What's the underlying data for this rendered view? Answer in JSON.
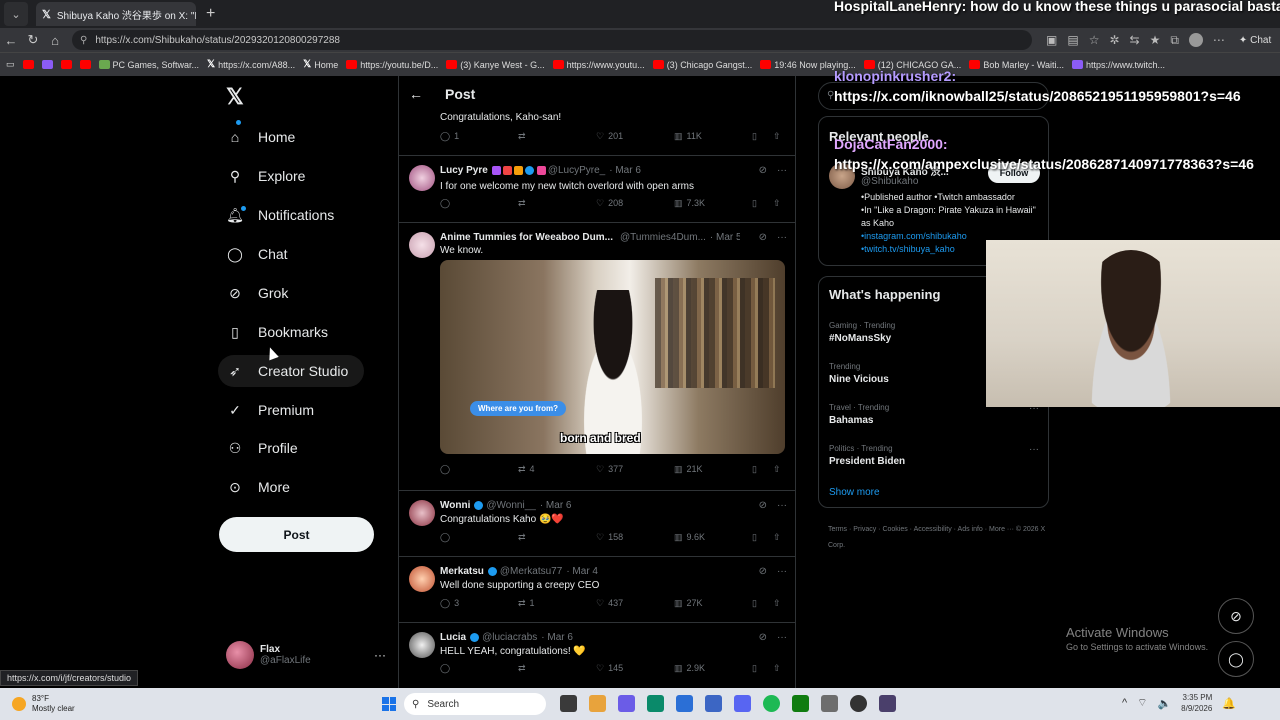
{
  "browser": {
    "tab_title": "Shibuya Kaho 渋谷果歩 on X: \"I'm",
    "url": "https://x.com/Shibukaho/status/2029320120800297288",
    "chat_label": "Chat",
    "bookmarks": [
      {
        "label": "",
        "icon": "youtube-icon"
      },
      {
        "label": "",
        "icon": "twitch-icon"
      },
      {
        "label": "",
        "icon": "youtube-icon"
      },
      {
        "label": "",
        "icon": "youtube-icon"
      },
      {
        "label": "PC Games, Softwar...",
        "icon": "game-icon"
      },
      {
        "label": "https://x.com/A88...",
        "icon": "x-icon"
      },
      {
        "label": "Home",
        "icon": "x-icon"
      },
      {
        "label": "https://youtu.be/D...",
        "icon": "youtube-icon"
      },
      {
        "label": "(3) Kanye West - G...",
        "icon": "youtube-icon"
      },
      {
        "label": "https://www.youtu...",
        "icon": "youtube-icon"
      },
      {
        "label": "(3) Chicago Gangst...",
        "icon": "youtube-icon"
      },
      {
        "label": "19:46 Now playing...",
        "icon": "youtube-icon"
      },
      {
        "label": "(12) CHICAGO GA...",
        "icon": "youtube-icon"
      },
      {
        "label": "Bob Marley - Waiti...",
        "icon": "youtube-icon"
      },
      {
        "label": "https://www.twitch...",
        "icon": "twitch-icon"
      }
    ]
  },
  "nav": {
    "items": [
      {
        "label": "Home",
        "icon": "home-icon"
      },
      {
        "label": "Explore",
        "icon": "search-icon"
      },
      {
        "label": "Notifications",
        "icon": "bell-icon"
      },
      {
        "label": "Chat",
        "icon": "chat-icon"
      },
      {
        "label": "Grok",
        "icon": "grok-icon"
      },
      {
        "label": "Bookmarks",
        "icon": "bookmark-icon"
      },
      {
        "label": "Creator Studio",
        "icon": "rocket-icon"
      },
      {
        "label": "Premium",
        "icon": "verified-icon"
      },
      {
        "label": "Profile",
        "icon": "person-icon"
      },
      {
        "label": "More",
        "icon": "more-icon"
      }
    ],
    "post_label": "Post",
    "account": {
      "name": "Flax",
      "handle": "@aFlaxLife"
    }
  },
  "header": {
    "title": "Post"
  },
  "tweets": [
    {
      "text": "Congratulations, Kaho-san!",
      "replies": "1",
      "retweets": "",
      "likes": "201",
      "views": "11K"
    },
    {
      "name": "Lucy Pyre",
      "handle": "@LucyPyre_",
      "date": "· Mar 6",
      "text": "I for one welcome my new twitch overlord with open arms",
      "replies": "",
      "retweets": "",
      "likes": "208",
      "views": "7.3K"
    },
    {
      "name": "Anime Tummies for Weeaboo Dum...",
      "handle": "@Tummies4Dum...",
      "date": "· Mar 5",
      "text": "We know.",
      "media_bubble": "Where are you from?",
      "media_caption": "born and bred",
      "replies": "",
      "retweets": "4",
      "likes": "377",
      "views": "21K"
    },
    {
      "name": "Wonni",
      "handle": "@Wonni__",
      "date": "· Mar 6",
      "text": "Congratulations Kaho 🥹❤️",
      "replies": "",
      "retweets": "",
      "likes": "158",
      "views": "9.6K"
    },
    {
      "name": "Merkatsu",
      "handle": "@Merkatsu77",
      "date": "· Mar 4",
      "text": "Well done supporting a creepy CEO",
      "replies": "3",
      "retweets": "1",
      "likes": "437",
      "views": "27K"
    },
    {
      "name": "Lucia",
      "handle": "@luciacrabs",
      "date": "· Mar 6",
      "text": "HELL YEAH, congratulations! 💛",
      "replies": "",
      "retweets": "",
      "likes": "145",
      "views": "2.9K"
    }
  ],
  "relevant": {
    "title": "Relevant people",
    "name": "Shibuya Kaho 渋...",
    "handle": "@Shibukaho",
    "follow_label": "Follow",
    "bio": [
      "•Published author •Twitch ambassador",
      "•In \"Like a Dragon: Pirate Yakuza in Hawaii\" as Kaho",
      "•instagram.com/shibukaho",
      "•twitch.tv/shibuya_kaho"
    ]
  },
  "happening": {
    "title": "What's happening",
    "trends": [
      {
        "meta": "Gaming · Trending",
        "name": "#NoMansSky"
      },
      {
        "meta": "Trending",
        "name": "Nine Vicious"
      },
      {
        "meta": "Travel · Trending",
        "name": "Bahamas"
      },
      {
        "meta": "Politics · Trending",
        "name": "President Biden"
      }
    ],
    "show_more": "Show more"
  },
  "footer": {
    "links": "Terms · Privacy · Cookies · Accessibility · Ads info · More ··· © 2026 X Corp."
  },
  "overlay_chat": [
    {
      "user": "HospitalLaneHenry:",
      "text": "how do u know these things u parasocial bastard"
    },
    {
      "user": "klonopinkrusher2:",
      "text": "https://x.com/iknowball25/status/2086521951195959801?s=46"
    },
    {
      "user": "DojaCatFan2000:",
      "text": "https://x.com/ampexclusive/status/2086287140971778363?s=46"
    }
  ],
  "windows": {
    "activate": "Activate Windows",
    "activate_sub": "Go to Settings to activate Windows."
  },
  "status_url": "https://x.com/i/jf/creators/studio",
  "taskbar": {
    "temp": "83°F",
    "weather": "Mostly clear",
    "search_placeholder": "Search",
    "time": "3:35 PM",
    "date": "8/9/2026"
  },
  "colors": {
    "accent": "#1d9bf0",
    "background": "#000000",
    "border": "#2f3336",
    "muted": "#71767b"
  }
}
